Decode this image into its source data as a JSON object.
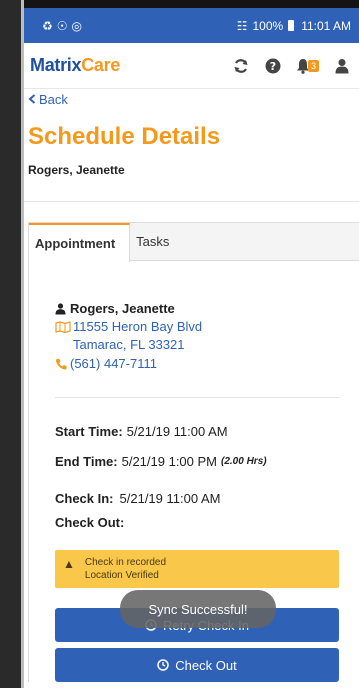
{
  "status_bar": {
    "left_icons": [
      "sync-icon",
      "location-icon",
      "target-icon"
    ],
    "battery": "100%",
    "time": "11:01 AM"
  },
  "header": {
    "logo_part1": "Matrix",
    "logo_part2": "Care",
    "notification_count": "3",
    "icons": [
      "refresh-icon",
      "help-icon",
      "bell-icon",
      "user-icon"
    ]
  },
  "nav": {
    "back_label": "Back"
  },
  "page": {
    "title": "Schedule Details",
    "client": "Rogers, Jeanette"
  },
  "tabs": [
    {
      "label": "Appointment",
      "active": true
    },
    {
      "label": "Tasks",
      "active": false
    }
  ],
  "appointment": {
    "contact_name": "Rogers, Jeanette",
    "address_line1": "11555 Heron Bay Blvd",
    "address_line2": "Tamarac, FL 33321",
    "phone": "(561) 447-7111",
    "start_label": "Start Time:",
    "start_value": "5/21/19 11:00 AM",
    "end_label": "End Time:",
    "end_value": "5/21/19 1:00 PM",
    "duration": "(2.00 Hrs)",
    "checkin_label": "Check In:",
    "checkin_value": "5/21/19 11:00 AM",
    "checkout_label": "Check Out:",
    "checkout_value": ""
  },
  "alert": {
    "line1": "Check in recorded",
    "line2": "Location Verified"
  },
  "buttons": {
    "retry": "Retry Check In",
    "checkout": "Check Out"
  },
  "toast": "Sync Successful!",
  "colors": {
    "primary": "#2f62b7",
    "accent": "#f39a1e",
    "alert": "#f9c74a"
  }
}
